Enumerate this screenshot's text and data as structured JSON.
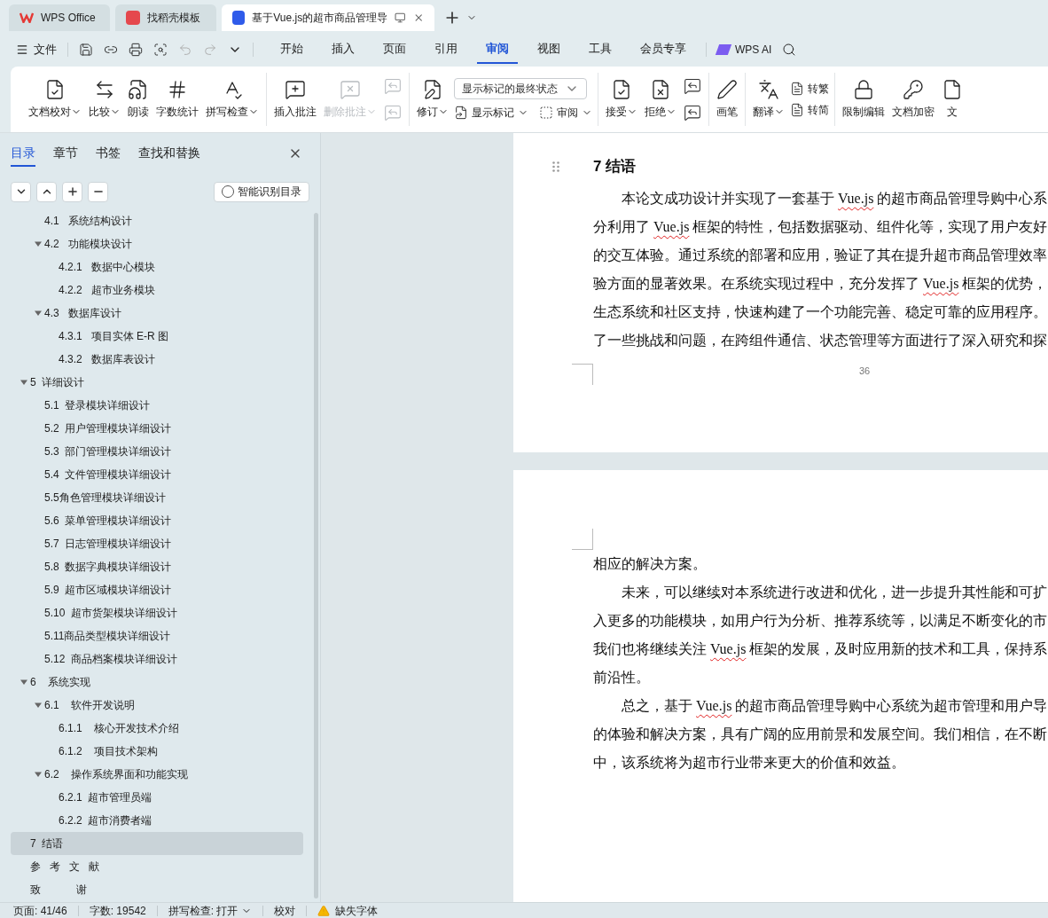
{
  "window_tabs": [
    {
      "kind": "wps",
      "label": "WPS Office",
      "selected": false
    },
    {
      "kind": "template",
      "label": "找稻壳模板",
      "selected": false
    },
    {
      "kind": "doc",
      "label": "基于Vue.js的超市商品管理导",
      "selected": true
    }
  ],
  "menu": {
    "file": "文件",
    "tabs": [
      {
        "label": "开始",
        "selected": false
      },
      {
        "label": "插入",
        "selected": false
      },
      {
        "label": "页面",
        "selected": false
      },
      {
        "label": "引用",
        "selected": false
      },
      {
        "label": "审阅",
        "selected": true
      },
      {
        "label": "视图",
        "selected": false
      },
      {
        "label": "工具",
        "selected": false
      },
      {
        "label": "会员专享",
        "selected": false
      }
    ],
    "ai": "WPS AI"
  },
  "ribbon": {
    "groups": [
      {
        "items": [
          {
            "kind": "large",
            "label": "文档校对",
            "dropdown": true,
            "disabled": false
          },
          {
            "kind": "large",
            "label": "比较",
            "dropdown": true,
            "disabled": false
          },
          {
            "kind": "large",
            "label": "朗读",
            "dropdown": false,
            "disabled": false
          },
          {
            "kind": "large",
            "label": "字数统计",
            "dropdown": false,
            "disabled": false
          },
          {
            "kind": "large",
            "label": "拼写检查",
            "dropdown": true,
            "disabled": false
          }
        ]
      },
      {
        "items": [
          {
            "kind": "large",
            "label": "插入批注",
            "dropdown": false,
            "disabled": false
          },
          {
            "kind": "large",
            "label": "删除批注",
            "dropdown": true,
            "disabled": true
          },
          {
            "kind": "column",
            "items": [
              {
                "kind": "icon",
                "disabled": true
              },
              {
                "kind": "icon",
                "disabled": true
              }
            ]
          }
        ]
      },
      {
        "items": [
          {
            "kind": "large",
            "label": "修订",
            "dropdown": true,
            "disabled": false
          },
          {
            "kind": "column",
            "items": [
              {
                "kind": "select",
                "value": "显示标记的最终状态"
              },
              {
                "kind": "row",
                "items": [
                  {
                    "kind": "small",
                    "label": "显示标记",
                    "dropdown": true,
                    "disabled": false
                  },
                  {
                    "kind": "small",
                    "label": "审阅",
                    "dropdown": true,
                    "disabled": false
                  }
                ]
              }
            ]
          }
        ]
      },
      {
        "items": [
          {
            "kind": "large",
            "label": "接受",
            "dropdown": true,
            "disabled": false
          },
          {
            "kind": "large",
            "label": "拒绝",
            "dropdown": true,
            "disabled": false
          },
          {
            "kind": "column",
            "items": [
              {
                "kind": "icon",
                "disabled": false
              },
              {
                "kind": "icon",
                "disabled": false
              }
            ]
          }
        ]
      },
      {
        "items": [
          {
            "kind": "large",
            "label": "画笔",
            "dropdown": false,
            "disabled": false
          }
        ]
      },
      {
        "items": [
          {
            "kind": "large",
            "label": "翻译",
            "dropdown": true,
            "disabled": false
          },
          {
            "kind": "column",
            "items": [
              {
                "kind": "small",
                "label": "转繁",
                "dropdown": false,
                "disabled": false
              },
              {
                "kind": "small",
                "label": "转简",
                "dropdown": false,
                "disabled": false
              }
            ]
          }
        ]
      },
      {
        "items": [
          {
            "kind": "large",
            "label": "限制编辑",
            "dropdown": false,
            "disabled": false
          },
          {
            "kind": "large",
            "label": "文档加密",
            "dropdown": false,
            "disabled": false
          },
          {
            "kind": "large",
            "label": "文",
            "dropdown": false,
            "disabled": false
          }
        ]
      }
    ]
  },
  "nav_panel": {
    "tabs": [
      {
        "label": "目录",
        "selected": true
      },
      {
        "label": "章节",
        "selected": false
      },
      {
        "label": "书签",
        "selected": false
      },
      {
        "label": "查找和替换",
        "selected": false
      }
    ],
    "smart_button": "智能识别目录",
    "toc": [
      {
        "children": [
          {
            "label": "4.1   系统结构设计",
            "selected": false
          },
          {
            "label": "4.2   功能模块设计",
            "expanded": true,
            "selected": false,
            "children": [
              {
                "label": "4.2.1   数据中心模块",
                "selected": false
              },
              {
                "label": "4.2.2   超市业务模块",
                "selected": false
              }
            ]
          },
          {
            "label": "4.3   数据库设计",
            "expanded": true,
            "selected": false,
            "children": [
              {
                "label": "4.3.1   项目实体 E-R 图",
                "selected": false
              },
              {
                "label": "4.3.2   数据库表设计",
                "selected": false
              }
            ]
          }
        ]
      },
      {
        "label": "5  详细设计",
        "expanded": true,
        "selected": false,
        "children": [
          {
            "label": "5.1  登录模块详细设计",
            "selected": false
          },
          {
            "label": "5.2  用户管理模块详细设计",
            "selected": false
          },
          {
            "label": "5.3  部门管理模块详细设计",
            "selected": false
          },
          {
            "label": "5.4  文件管理模块详细设计",
            "selected": false
          },
          {
            "label": "5.5角色管理模块详细设计",
            "selected": false
          },
          {
            "label": "5.6  菜单管理模块详细设计",
            "selected": false
          },
          {
            "label": "5.7  日志管理模块详细设计",
            "selected": false
          },
          {
            "label": "5.8  数据字典模块详细设计",
            "selected": false
          },
          {
            "label": "5.9  超市区域模块详细设计",
            "selected": false
          },
          {
            "label": "5.10  超市货架模块详细设计",
            "selected": false
          },
          {
            "label": "5.11商品类型模块详细设计",
            "selected": false
          },
          {
            "label": "5.12  商品档案模块详细设计",
            "selected": false
          }
        ]
      },
      {
        "label": "6    系统实现",
        "expanded": true,
        "selected": false,
        "children": [
          {
            "label": "6.1    软件开发说明",
            "expanded": true,
            "selected": false,
            "children": [
              {
                "label": "6.1.1    核心开发技术介绍",
                "selected": false
              },
              {
                "label": "6.1.2    项目技术架构",
                "selected": false
              }
            ]
          },
          {
            "label": "6.2    操作系统界面和功能实现",
            "expanded": true,
            "selected": false,
            "children": [
              {
                "label": "6.2.1  超市管理员端",
                "selected": false
              },
              {
                "label": "6.2.2  超市消费者端",
                "selected": false
              }
            ]
          }
        ]
      },
      {
        "label": "7  结语",
        "selected": true
      },
      {
        "label": "参   考   文   献",
        "selected": false
      },
      {
        "label": "致            谢",
        "selected": false
      }
    ]
  },
  "pages": [
    {
      "heading": "7  结语",
      "paragraphs": [
        {
          "indent": true,
          "lines": [
            [
              {
                "text": "本论文成功设计并实现了一套基于 "
              },
              {
                "text": "Vue.js",
                "spelling_error": true
              },
              {
                "text": " 的超市商品管理导购中心系"
              }
            ],
            [
              {
                "text": "分利用了 "
              },
              {
                "text": "Vue.js",
                "spelling_error": true
              },
              {
                "text": " 框架的特性，包括数据驱动、组件化等，实现了用户友好"
              }
            ],
            [
              {
                "text": "的交互体验。通过系统的部署和应用，验证了其在提升超市商品管理效率"
              }
            ],
            [
              {
                "text": "验方面的显著效果。在系统实现过程中，充分发挥了 "
              },
              {
                "text": "Vue.js",
                "spelling_error": true
              },
              {
                "text": " 框架的优势，"
              }
            ],
            [
              {
                "text": "生态系统和社区支持，快速构建了一个功能完善、稳定可靠的应用程序。"
              }
            ],
            [
              {
                "text": "了一些挑战和问题，在跨组件通信、状态管理等方面进行了深入研究和探"
              }
            ]
          ]
        }
      ],
      "page_number": "36"
    },
    {
      "paragraphs": [
        {
          "indent": false,
          "lines": [
            [
              {
                "text": "相应的解决方案。"
              }
            ]
          ]
        },
        {
          "indent": true,
          "lines": [
            [
              {
                "text": "未来，可以继续对本系统进行改进和优化，进一步提升其性能和可扩"
              }
            ],
            [
              {
                "text": "入更多的功能模块，如用户行为分析、推荐系统等，以满足不断变化的市"
              }
            ],
            [
              {
                "text": "我们也将继续关注 "
              },
              {
                "text": "Vue.js",
                "spelling_error": true
              },
              {
                "text": " 框架的发展，及时应用新的技术和工具，保持系"
              }
            ],
            [
              {
                "text": "前沿性。"
              }
            ]
          ]
        },
        {
          "indent": true,
          "lines": [
            [
              {
                "text": "总之，基于 "
              },
              {
                "text": "Vue.js",
                "spelling_error": true
              },
              {
                "text": " 的超市商品管理导购中心系统为超市管理和用户导"
              }
            ],
            [
              {
                "text": "的体验和解决方案，具有广阔的应用前景和发展空间。我们相信，在不断"
              }
            ],
            [
              {
                "text": "中，该系统将为超市行业带来更大的价值和效益。"
              }
            ]
          ]
        }
      ]
    }
  ],
  "status_bar": {
    "page": "页面: 41/46",
    "words": "字数: 19542",
    "spell_check": "拼写检查: 打开",
    "proofread": "校对",
    "missing_fonts": "缺失字体"
  }
}
